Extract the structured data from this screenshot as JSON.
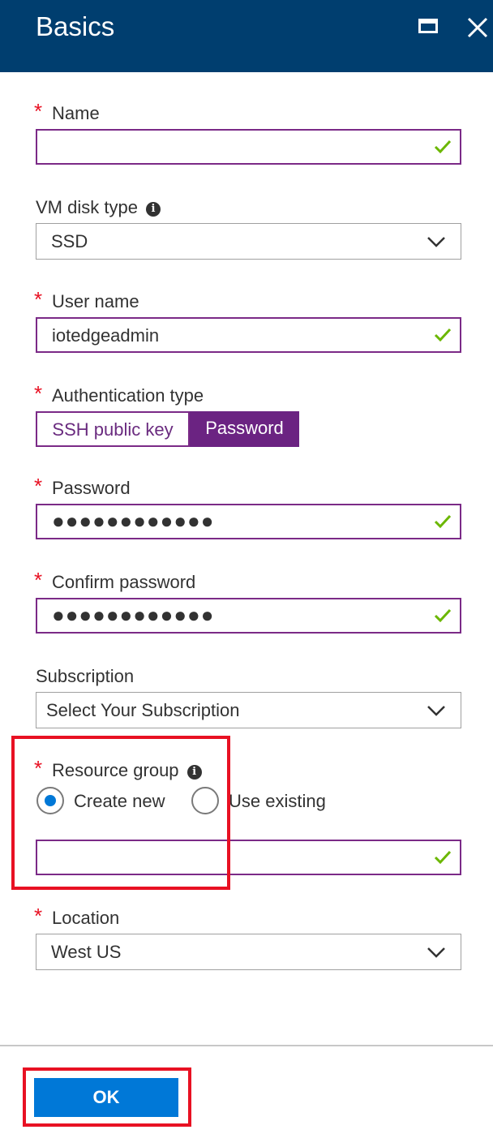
{
  "header": {
    "title": "Basics"
  },
  "fields": {
    "name": {
      "label": "Name",
      "value": ""
    },
    "disk": {
      "label": "VM disk type",
      "value": "SSD"
    },
    "username": {
      "label": "User name",
      "value": "iotedgeadmin"
    },
    "auth": {
      "label": "Authentication type",
      "options": [
        "SSH public key",
        "Password"
      ],
      "selected": "Password"
    },
    "password": {
      "label": "Password",
      "value": "●●●●●●●●●●●●"
    },
    "confirm": {
      "label": "Confirm password",
      "value": "●●●●●●●●●●●●"
    },
    "subscription": {
      "label": "Subscription",
      "value": "Select Your Subscription"
    },
    "resource_group": {
      "label": "Resource group",
      "options": [
        "Create new",
        "Use existing"
      ],
      "selected": "Create new",
      "value": ""
    },
    "location": {
      "label": "Location",
      "value": "West US"
    }
  },
  "footer": {
    "ok_label": "OK"
  },
  "colors": {
    "header_bg": "#003e6f",
    "accent": "#7b2a87",
    "ok_bg": "#0078d7",
    "required": "#e81123",
    "valid": "#6bb700"
  }
}
